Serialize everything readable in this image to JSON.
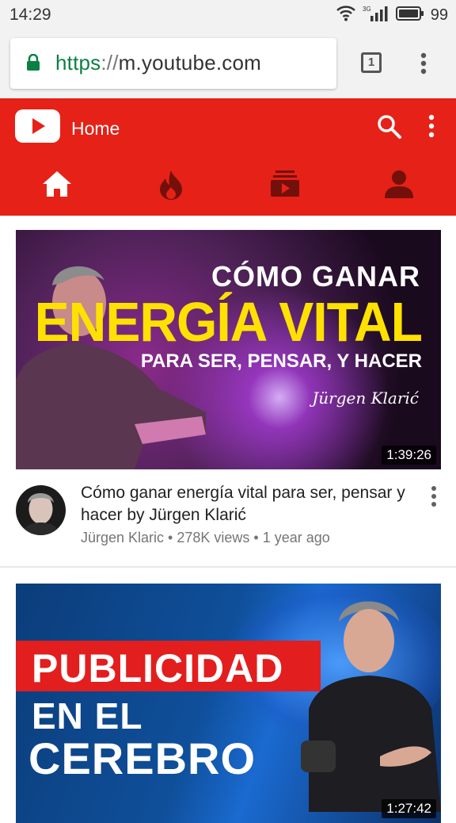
{
  "status_bar": {
    "time": "14:29",
    "network": "3G",
    "battery": "99"
  },
  "browser": {
    "url_scheme": "https",
    "url_separator": "://",
    "url_host": "m.youtube.com",
    "tab_count": "1"
  },
  "header": {
    "title": "Home",
    "accent_color": "#e62117",
    "nav_tabs": [
      {
        "name": "home",
        "icon": "home-icon"
      },
      {
        "name": "trending",
        "icon": "flame-icon"
      },
      {
        "name": "subscriptions",
        "icon": "subscriptions-icon"
      },
      {
        "name": "account",
        "icon": "person-icon"
      }
    ]
  },
  "videos": [
    {
      "thumb_line1": "CÓMO GANAR",
      "thumb_line2": "ENERGÍA VITAL",
      "thumb_line3": "PARA SER, PENSAR, Y HACER",
      "thumb_signature": "Jürgen Klarić",
      "duration": "1:39:26",
      "title": "Cómo ganar energía vital para ser, pensar y hacer by Jürgen Klarić",
      "subtitle": "Jürgen Klaric • 278K views • 1 year ago"
    },
    {
      "thumb_line1": "PUBLICIDAD",
      "thumb_line2": "EN EL",
      "thumb_line3": "CEREBRO",
      "duration": "1:27:42"
    }
  ]
}
